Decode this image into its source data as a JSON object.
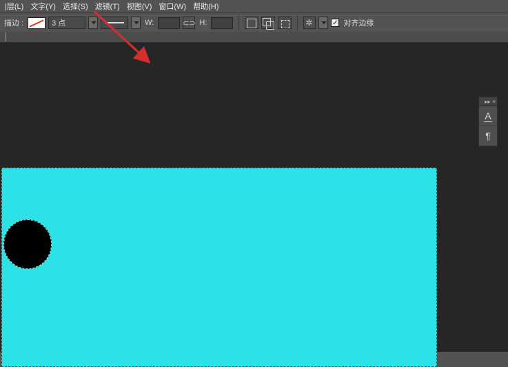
{
  "menu": {
    "layer": "|层(L)",
    "text": "文字(Y)",
    "select": "选择(S)",
    "filter": "滤镜(T)",
    "view": "视图(V)",
    "window": "窗口(W)",
    "help": "帮助(H)"
  },
  "options": {
    "stroke_label": "描边 :",
    "stroke_swatch_color": "#ffffff",
    "stroke_swatch_diag": "#e53226",
    "weight_value": "3 点",
    "width_label": "W:",
    "width_value": "",
    "link_icon": "⊂⊃",
    "height_label": "H:",
    "height_value": "",
    "align_edges_label": "对齐边缘",
    "align_edges_checked": true
  },
  "panel": {
    "collapse_icon": "▸▸",
    "close_icon": "×",
    "character_icon": "A",
    "paragraph_icon": "¶"
  },
  "canvas": {
    "bg_color": "#2de2e6",
    "circle_color": "#000000"
  },
  "annotation": {
    "arrow_color": "#d32f2f"
  }
}
